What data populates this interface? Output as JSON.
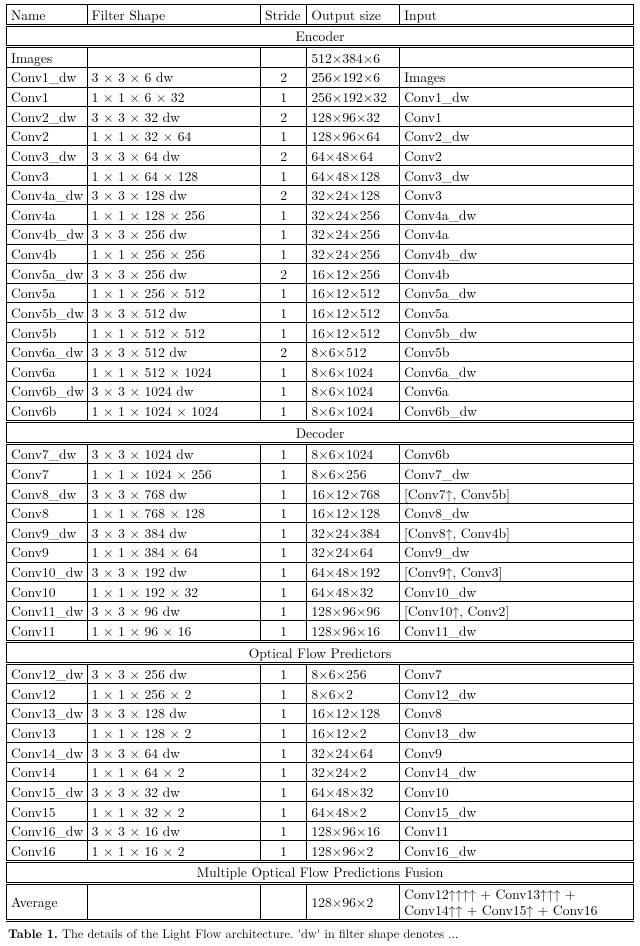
{
  "header": {
    "c1": "Name",
    "c2": "Filter Shape",
    "c3": "Stride",
    "c4": "Output size",
    "c5": "Input"
  },
  "sections": [
    {
      "title": "Encoder",
      "rows": [
        {
          "name": "Images",
          "shape": "",
          "stride": "",
          "out": "512×384×6",
          "in": ""
        },
        {
          "name": "Conv1_dw",
          "shape": "3 × 3 × 6 dw",
          "stride": "2",
          "out": "256×192×6",
          "in": "Images"
        },
        {
          "name": "Conv1",
          "shape": "1 × 1 × 6 × 32",
          "stride": "1",
          "out": "256×192×32",
          "in": "Conv1_dw"
        },
        {
          "name": "Conv2_dw",
          "shape": "3 × 3 × 32 dw",
          "stride": "2",
          "out": "128×96×32",
          "in": "Conv1"
        },
        {
          "name": "Conv2",
          "shape": "1 × 1 × 32 × 64",
          "stride": "1",
          "out": "128×96×64",
          "in": "Conv2_dw"
        },
        {
          "name": "Conv3_dw",
          "shape": "3 × 3 × 64 dw",
          "stride": "2",
          "out": "64×48×64",
          "in": "Conv2"
        },
        {
          "name": "Conv3",
          "shape": "1 × 1 × 64 × 128",
          "stride": "1",
          "out": "64×48×128",
          "in": "Conv3_dw"
        },
        {
          "name": "Conv4a_dw",
          "shape": "3 × 3 × 128 dw",
          "stride": "2",
          "out": "32×24×128",
          "in": "Conv3"
        },
        {
          "name": "Conv4a",
          "shape": "1 × 1 × 128 × 256",
          "stride": "1",
          "out": "32×24×256",
          "in": "Conv4a_dw"
        },
        {
          "name": "Conv4b_dw",
          "shape": "3 × 3 × 256 dw",
          "stride": "1",
          "out": "32×24×256",
          "in": "Conv4a"
        },
        {
          "name": "Conv4b",
          "shape": "1 × 1 × 256 × 256",
          "stride": "1",
          "out": "32×24×256",
          "in": "Conv4b_dw"
        },
        {
          "name": "Conv5a_dw",
          "shape": "3 × 3 × 256 dw",
          "stride": "2",
          "out": "16×12×256",
          "in": "Conv4b"
        },
        {
          "name": "Conv5a",
          "shape": "1 × 1 × 256 × 512",
          "stride": "1",
          "out": "16×12×512",
          "in": "Conv5a_dw"
        },
        {
          "name": "Conv5b_dw",
          "shape": "3 × 3 × 512 dw",
          "stride": "1",
          "out": "16×12×512",
          "in": "Conv5a"
        },
        {
          "name": "Conv5b",
          "shape": "1 × 1 × 512 × 512",
          "stride": "1",
          "out": "16×12×512",
          "in": "Conv5b_dw"
        },
        {
          "name": "Conv6a_dw",
          "shape": "3 × 3 × 512 dw",
          "stride": "2",
          "out": "8×6×512",
          "in": "Conv5b"
        },
        {
          "name": "Conv6a",
          "shape": "1 × 1 × 512 × 1024",
          "stride": "1",
          "out": "8×6×1024",
          "in": "Conv6a_dw"
        },
        {
          "name": "Conv6b_dw",
          "shape": "3 × 3 × 1024 dw",
          "stride": "1",
          "out": "8×6×1024",
          "in": "Conv6a"
        },
        {
          "name": "Conv6b",
          "shape": "1 × 1 × 1024 × 1024",
          "stride": "1",
          "out": "8×6×1024",
          "in": "Conv6b_dw"
        }
      ]
    },
    {
      "title": "Decoder",
      "rows": [
        {
          "name": "Conv7_dw",
          "shape": "3 × 3 × 1024 dw",
          "stride": "1",
          "out": "8×6×1024",
          "in": "Conv6b"
        },
        {
          "name": "Conv7",
          "shape": "1 × 1 × 1024 × 256",
          "stride": "1",
          "out": "8×6×256",
          "in": "Conv7_dw"
        },
        {
          "name": "Conv8_dw",
          "shape": "3 × 3 × 768 dw",
          "stride": "1",
          "out": "16×12×768",
          "in": "[Conv7↑, Conv5b]"
        },
        {
          "name": "Conv8",
          "shape": "1 × 1 × 768 × 128",
          "stride": "1",
          "out": "16×12×128",
          "in": "Conv8_dw"
        },
        {
          "name": "Conv9_dw",
          "shape": "3 × 3 × 384 dw",
          "stride": "1",
          "out": "32×24×384",
          "in": "[Conv8↑, Conv4b]"
        },
        {
          "name": "Conv9",
          "shape": "1 × 1 × 384 × 64",
          "stride": "1",
          "out": "32×24×64",
          "in": "Conv9_dw"
        },
        {
          "name": "Conv10_dw",
          "shape": "3 × 3 × 192 dw",
          "stride": "1",
          "out": "64×48×192",
          "in": "[Conv9↑, Conv3]"
        },
        {
          "name": "Conv10",
          "shape": "1 × 1 × 192 × 32",
          "stride": "1",
          "out": "64×48×32",
          "in": "Conv10_dw"
        },
        {
          "name": "Conv11_dw",
          "shape": "3 × 3 × 96 dw",
          "stride": "1",
          "out": "128×96×96",
          "in": "[Conv10↑, Conv2]"
        },
        {
          "name": "Conv11",
          "shape": "1 × 1 × 96 × 16",
          "stride": "1",
          "out": "128×96×16",
          "in": "Conv11_dw"
        }
      ]
    },
    {
      "title": "Optical Flow Predictors",
      "rows": [
        {
          "name": "Conv12_dw",
          "shape": "3 × 3 × 256 dw",
          "stride": "1",
          "out": "8×6×256",
          "in": "Conv7"
        },
        {
          "name": "Conv12",
          "shape": "1 × 1 × 256 × 2",
          "stride": "1",
          "out": "8×6×2",
          "in": "Conv12_dw"
        },
        {
          "name": "Conv13_dw",
          "shape": "3 × 3 × 128 dw",
          "stride": "1",
          "out": "16×12×128",
          "in": "Conv8"
        },
        {
          "name": "Conv13",
          "shape": "1 × 1 × 128 × 2",
          "stride": "1",
          "out": "16×12×2",
          "in": "Conv13_dw"
        },
        {
          "name": "Conv14_dw",
          "shape": "3 × 3 × 64 dw",
          "stride": "1",
          "out": "32×24×64",
          "in": "Conv9"
        },
        {
          "name": "Conv14",
          "shape": "1 × 1 × 64 × 2",
          "stride": "1",
          "out": "32×24×2",
          "in": "Conv14_dw"
        },
        {
          "name": "Conv15_dw",
          "shape": "3 × 3 × 32 dw",
          "stride": "1",
          "out": "64×48×32",
          "in": "Conv10"
        },
        {
          "name": "Conv15",
          "shape": "1 × 1 × 32 × 2",
          "stride": "1",
          "out": "64×48×2",
          "in": "Conv15_dw"
        },
        {
          "name": "Conv16_dw",
          "shape": "3 × 3 × 16 dw",
          "stride": "1",
          "out": "128×96×16",
          "in": "Conv11"
        },
        {
          "name": "Conv16",
          "shape": "1 × 1 × 16 × 2",
          "stride": "1",
          "out": "128×96×2",
          "in": "Conv16_dw"
        }
      ]
    },
    {
      "title": "Multiple Optical Flow Predictions Fusion",
      "rows": [
        {
          "name": "Average",
          "shape": "",
          "stride": "",
          "out": "128×96×2",
          "in": "Conv12↑↑↑↑ + Conv13↑↑↑ + Conv14↑↑ + Conv15↑ + Conv16"
        }
      ]
    }
  ],
  "caption": {
    "label": "Table 1.",
    "text": " The details of the Light Flow architecture. 'dw' in filter shape denotes ..."
  }
}
